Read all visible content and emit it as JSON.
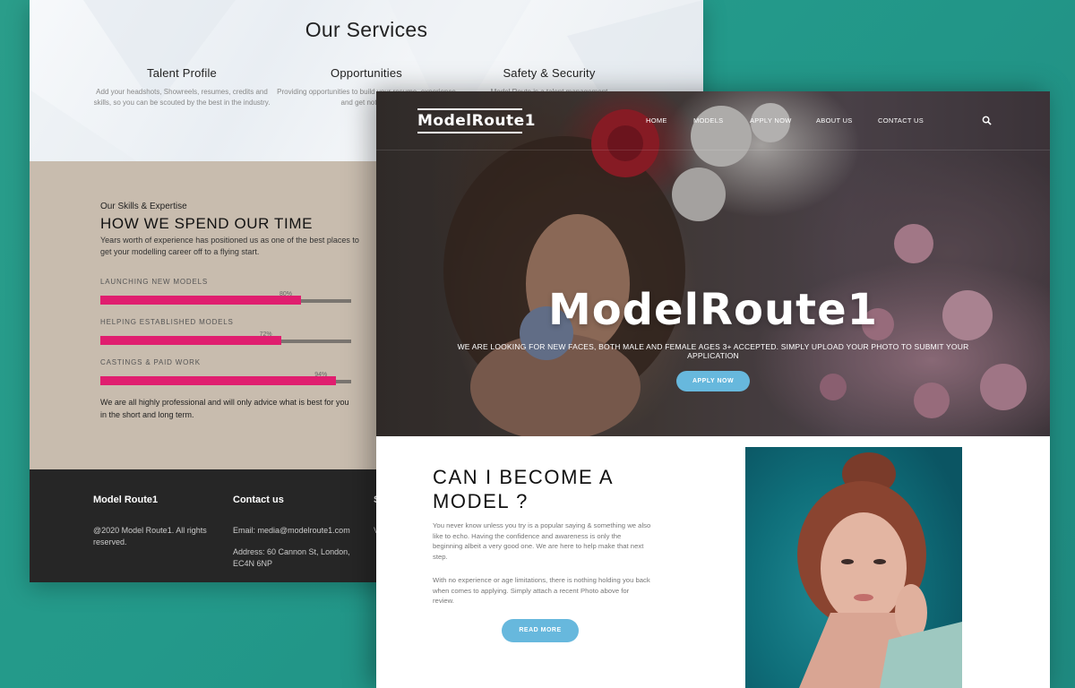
{
  "back_page": {
    "services": {
      "title": "Our Services",
      "items": [
        {
          "title": "Talent Profile",
          "text": "Add your headshots, Showreels, resumes, credits and skills, so you can be scouted by the best in the industry."
        },
        {
          "title": "Opportunities",
          "text": "Providing opportunities to build your resume, experience and get noticed."
        },
        {
          "title": "Safety & Security",
          "text": "Model Route is a talent management"
        }
      ]
    },
    "skills": {
      "kicker": "Our Skills & Expertise",
      "title": "HOW WE SPEND OUR TIME",
      "intro": "Years worth of experience has positioned us as one of the best places to get your modelling career off to a flying start.",
      "bars": [
        {
          "label": "LAUNCHING NEW MODELS",
          "percent_label": "80%",
          "percent": 80
        },
        {
          "label": "HELPING ESTABLISHED MODELS",
          "percent_label": "72%",
          "percent": 72
        },
        {
          "label": "CASTINGS & PAID WORK",
          "percent_label": "94%",
          "percent": 94
        }
      ],
      "outro": "We are all highly professional and will only advice what is best for you in the short and long term."
    },
    "footer": {
      "col1_head": "Model Route1",
      "col1_text": "@2020 Model Route1. All rights reserved.",
      "col2_head": "Contact us",
      "col2_email": "Email: media@modelroute1.com",
      "col2_address": "Address: 60 Cannon St, London, EC4N 6NP",
      "col3_head": "S",
      "col3_text": "V"
    }
  },
  "front_page": {
    "logo": "ModelRoute1",
    "nav": [
      "HOME",
      "MODELS",
      "APPLY NOW",
      "ABOUT US",
      "CONTACT US"
    ],
    "search_icon": "search-icon",
    "hero": {
      "title": "ModelRoute1",
      "subtitle": "WE ARE LOOKING FOR NEW FACES, BOTH MALE AND FEMALE AGES 3+ ACCEPTED. SIMPLY UPLOAD YOUR PHOTO TO SUBMIT YOUR APPLICATION",
      "button": "APPLY NOW"
    },
    "cta": {
      "title": "CAN I BECOME A MODEL ?",
      "p1": "You never know unless you try is a popular saying & something we also like to echo. Having the confidence and awareness is only the beginning albeit a very good one. We are here to help make that next step.",
      "p2": "With no experience or age limitations, there is nothing holding you back when comes to applying. Simply attach a recent Photo above for review.",
      "button": "READ MORE"
    }
  },
  "colors": {
    "background_teal": "#23998a",
    "accent_pink": "#e01e6f",
    "button_blue": "#67b8dd",
    "skills_beige": "#c8bcae",
    "footer_dark": "#262626"
  }
}
